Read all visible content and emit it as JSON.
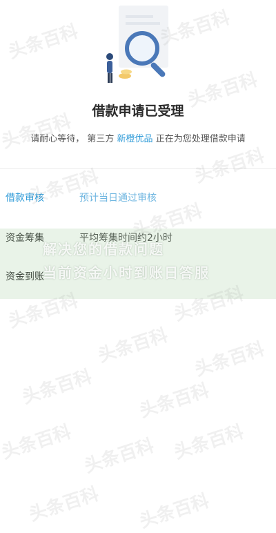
{
  "page": {
    "title": "借款申请已受理",
    "subtitle_prefix": "请耐心等待， 第三方 ",
    "subtitle_brand": "新橙优品",
    "subtitle_suffix": " 正在为您处理借款申请"
  },
  "steps": [
    {
      "label": "借款审核",
      "desc": "预计当日通过审核",
      "state": "active"
    },
    {
      "label": "资金筹集",
      "desc": "平均筹集时间约2小时",
      "state": "pending"
    },
    {
      "label": "资金到账",
      "desc": "",
      "state": "pending"
    }
  ],
  "overlay": {
    "line1": "解决您的借款问题",
    "line2": "当前资金小时到账日答服"
  },
  "watermark": "头条百科",
  "colors": {
    "accent": "#2f9bd8",
    "text": "#333333"
  }
}
